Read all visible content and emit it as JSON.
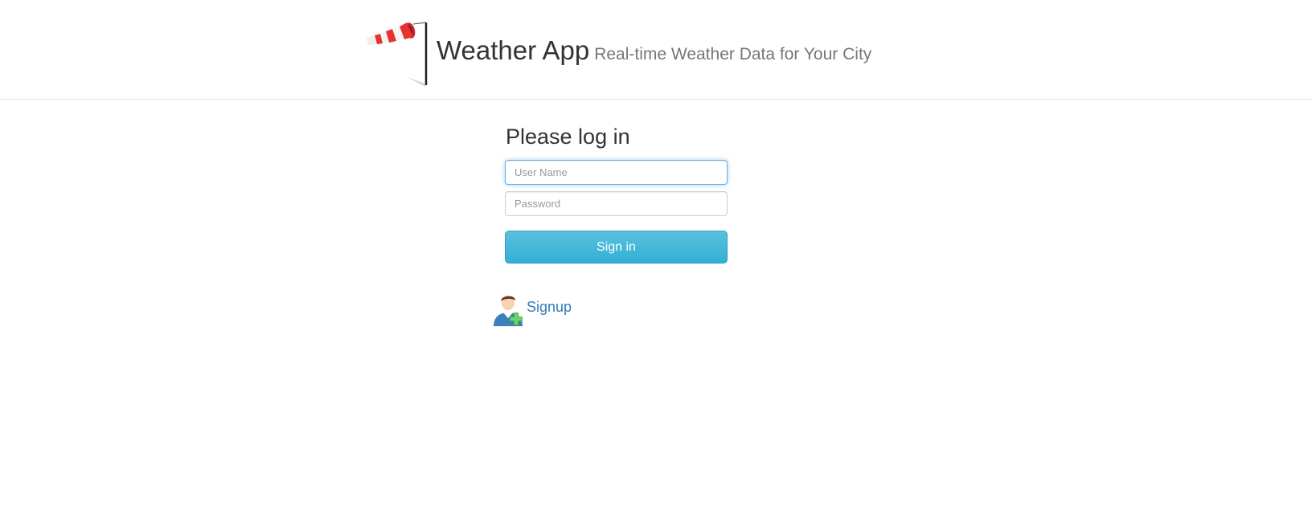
{
  "header": {
    "title": "Weather App",
    "subtitle": "Real-time Weather Data for Your City",
    "logo_icon": "windsock-icon"
  },
  "login": {
    "heading": "Please log in",
    "username_placeholder": "User Name",
    "username_value": "",
    "password_placeholder": "Password",
    "password_value": "",
    "submit_label": "Sign in"
  },
  "signup": {
    "label": "Signup",
    "icon": "add-user-icon"
  },
  "colors": {
    "button_top": "#5bc0de",
    "button_bottom": "#31b0d5",
    "link": "#337ab7",
    "focus_border": "#66afe9"
  }
}
